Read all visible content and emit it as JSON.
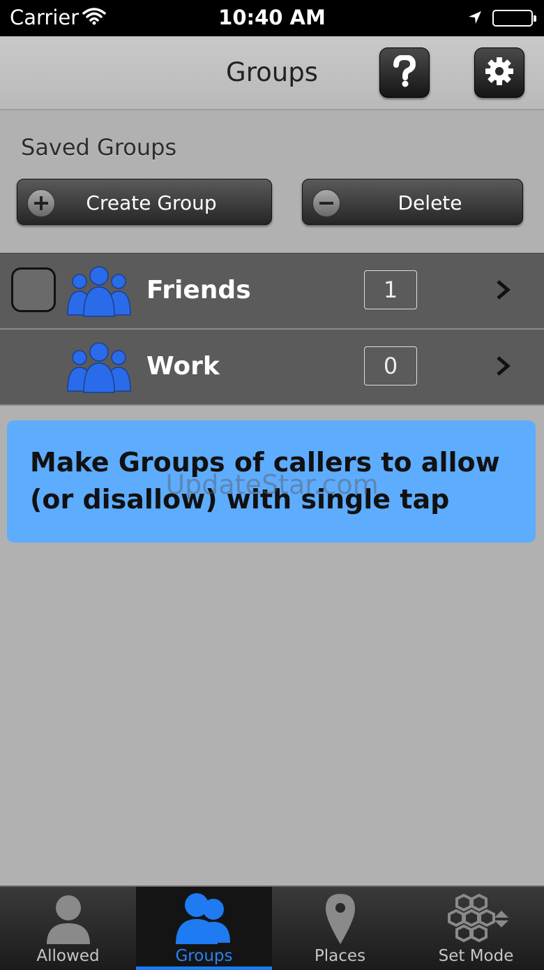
{
  "status_bar": {
    "carrier": "Carrier",
    "time": "10:40 AM"
  },
  "nav": {
    "title": "Groups",
    "help_icon": "question-mark-icon",
    "settings_icon": "gear-icon"
  },
  "section": {
    "title": "Saved Groups"
  },
  "actions": {
    "create_label": "Create Group",
    "delete_label": "Delete"
  },
  "groups": [
    {
      "name": "Friends",
      "count": "1",
      "icon": "group-people-icon",
      "checked": false
    },
    {
      "name": "Work",
      "count": "0",
      "icon": "group-people-icon"
    }
  ],
  "info": {
    "text": "Make Groups of callers to allow (or disallow) with single tap"
  },
  "watermark": "UpdateStar.com",
  "tabs": [
    {
      "label": "Allowed",
      "icon": "person-icon"
    },
    {
      "label": "Groups",
      "icon": "group-icon"
    },
    {
      "label": "Places",
      "icon": "map-pin-icon"
    },
    {
      "label": "Set Mode",
      "icon": "hexagon-mode-icon"
    }
  ],
  "colors": {
    "accent_blue": "#2b82f5",
    "info_box": "#5eacfe",
    "row_bg": "#5b5b5b",
    "background": "#b1b1b1"
  }
}
